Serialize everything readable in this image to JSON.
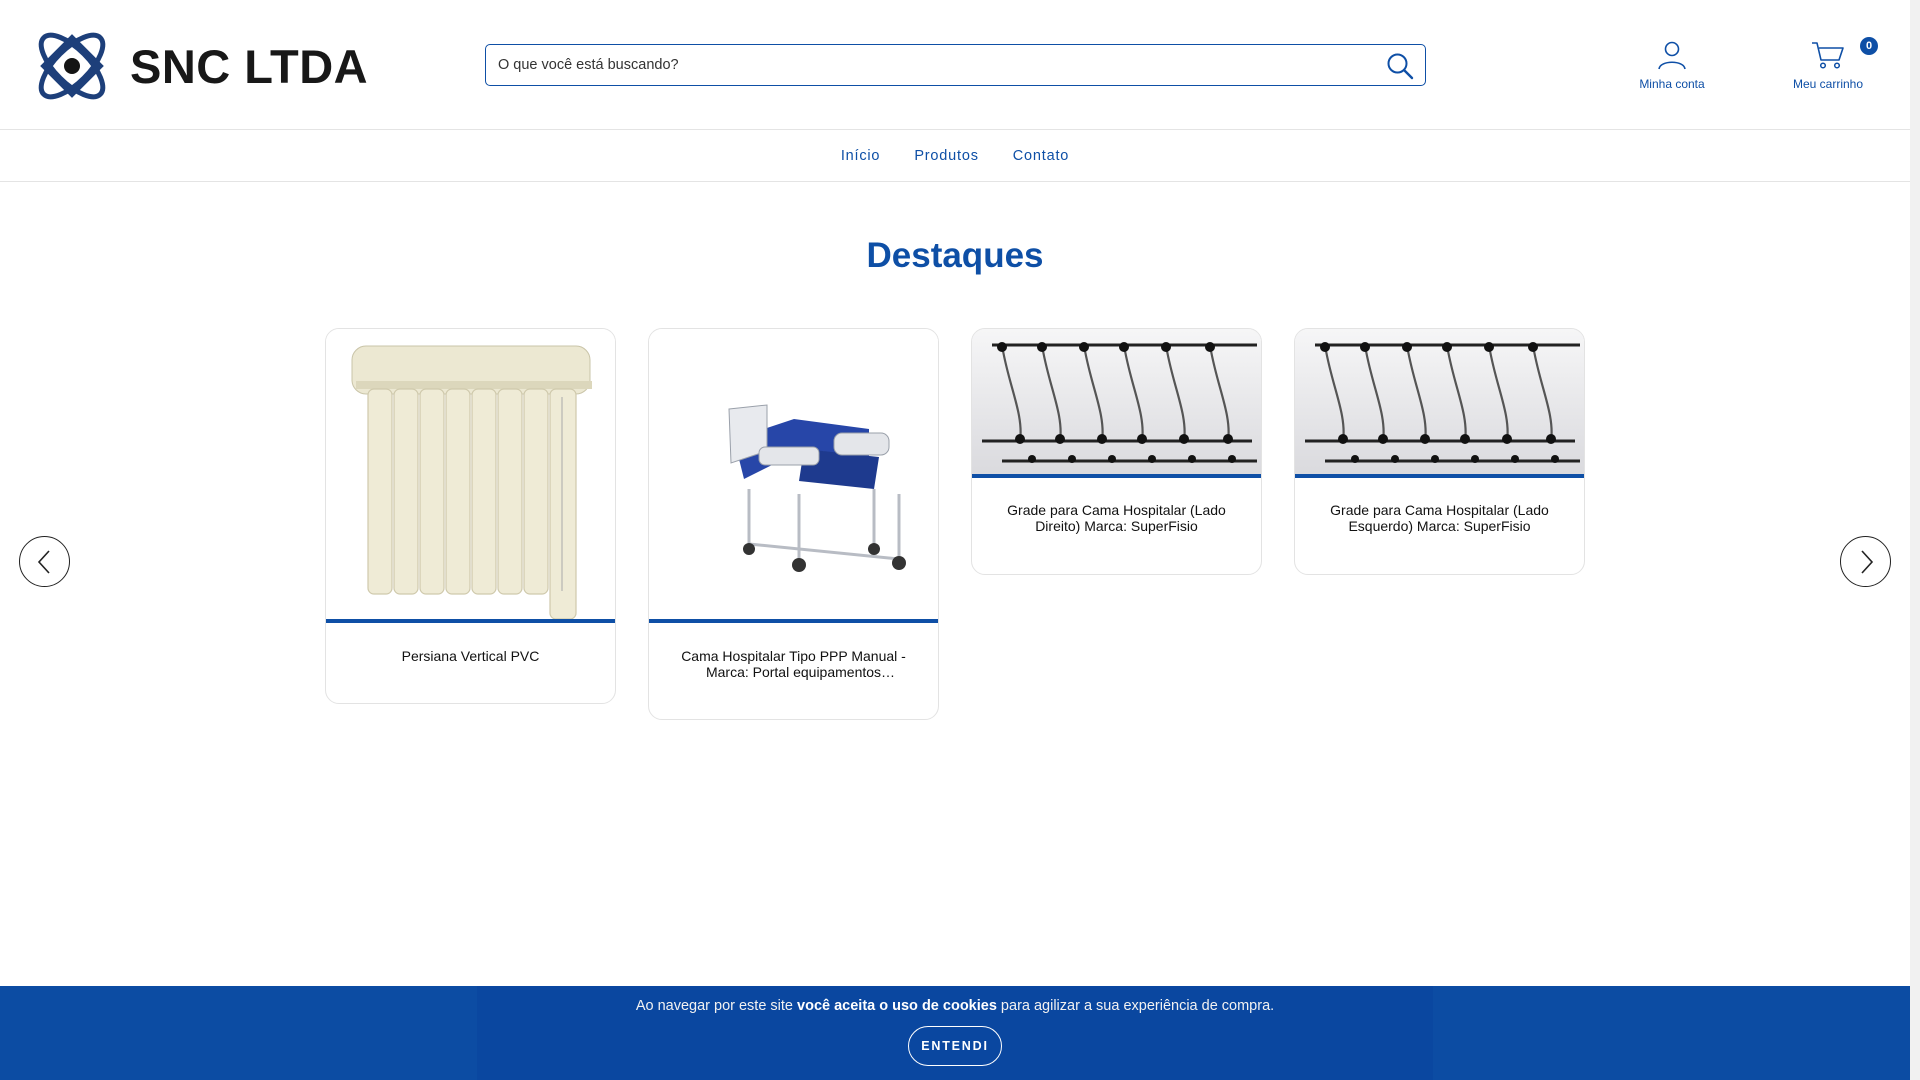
{
  "brand": {
    "name": "SNC LTDA",
    "accent": "#0e4fa6"
  },
  "search": {
    "placeholder": "O que você está buscando?",
    "icon": "search-icon"
  },
  "account": {
    "label": "Minha conta",
    "icon": "user-icon"
  },
  "cart": {
    "label": "Meu carrinho",
    "count": "0",
    "icon": "cart-icon"
  },
  "nav": {
    "items": [
      {
        "label": "Início"
      },
      {
        "label": "Produtos"
      },
      {
        "label": "Contato"
      }
    ]
  },
  "featured": {
    "title": "Destaques",
    "products": [
      {
        "name": "Persiana Vertical PVC"
      },
      {
        "name": "Cama Hospitalar Tipo PPP Manual - Marca: Portal equipamentos hospitalares"
      },
      {
        "name": "Grade para Cama Hospitalar (Lado Direito) Marca: SuperFisio"
      },
      {
        "name": "Grade para Cama Hospitalar (Lado Esquerdo) Marca: SuperFisio"
      }
    ]
  },
  "cookie": {
    "text_before": "Ao navegar por este site ",
    "text_bold": "você aceita o uso de cookies",
    "text_after": " para agilizar a sua experiência de compra.",
    "button": "ENTENDI"
  }
}
